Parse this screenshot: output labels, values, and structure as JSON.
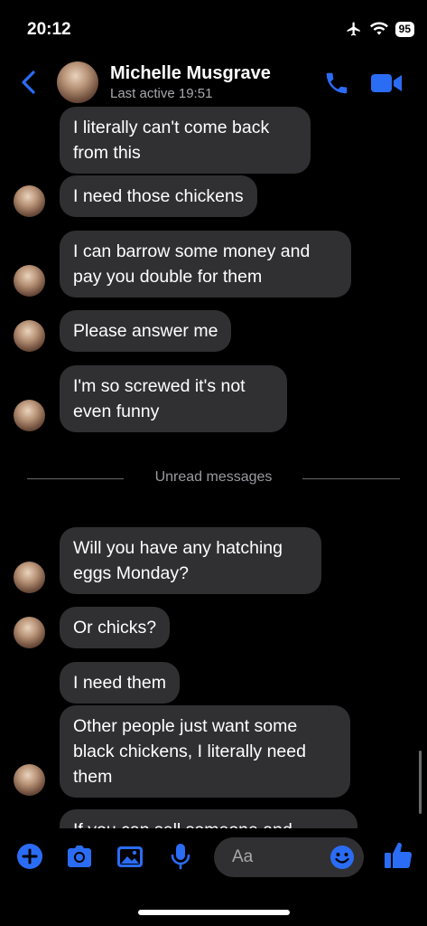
{
  "status_bar": {
    "time": "20:12",
    "battery": "95",
    "icons": [
      "airplane-icon",
      "wifi-icon",
      "battery-icon"
    ]
  },
  "header": {
    "contact_name": "Michelle Musgrave",
    "last_active": "Last active 19:51",
    "accent_color": "#2b6cf5"
  },
  "messages": {
    "before_divider": [
      "I literally can't come back from this",
      "I need those chickens",
      "I can barrow some money and pay you double for them",
      "Please answer me",
      "I'm so screwed it's not even funny"
    ],
    "divider_label": "Unread messages",
    "after_divider": [
      "Will you have any hatching eggs Monday?",
      "Or chicks?",
      "I need them",
      "Other people just want some black chickens, I literally need them",
      "If you can sell someone and"
    ]
  },
  "composer": {
    "placeholder": "Aa",
    "buttons": [
      "plus-icon",
      "camera-icon",
      "image-icon",
      "microphone-icon",
      "emoji-icon",
      "thumbs-up-icon"
    ]
  }
}
